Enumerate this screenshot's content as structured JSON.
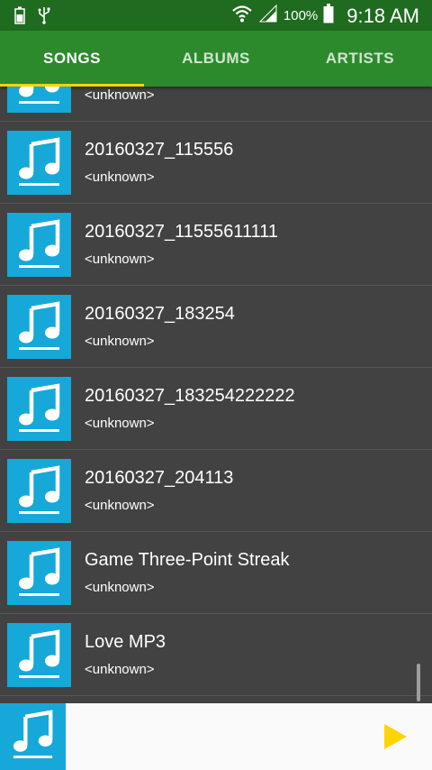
{
  "status_bar": {
    "battery_percent": "100%",
    "time": "9:18 AM",
    "icons": [
      "battery-saver-icon",
      "usb-icon",
      "wifi-icon",
      "signal-icon",
      "battery-icon"
    ]
  },
  "tabs": [
    {
      "label": "SONGS",
      "active": true
    },
    {
      "label": "ALBUMS",
      "active": false
    },
    {
      "label": "ARTISTS",
      "active": false
    }
  ],
  "songs": [
    {
      "title": "",
      "artist": "<unknown>"
    },
    {
      "title": "20160327_115556",
      "artist": "<unknown>"
    },
    {
      "title": "20160327_11555611111",
      "artist": "<unknown>"
    },
    {
      "title": "20160327_183254",
      "artist": "<unknown>"
    },
    {
      "title": "20160327_183254222222",
      "artist": "<unknown>"
    },
    {
      "title": "20160327_204113",
      "artist": "<unknown>"
    },
    {
      "title": "Game Three-Point Streak",
      "artist": "<unknown>"
    },
    {
      "title": "Love MP3",
      "artist": "<unknown>"
    }
  ],
  "colors": {
    "status_bar": "#1f6b1f",
    "tab_bar": "#2c8a2c",
    "tab_indicator": "#ffd400",
    "list_background": "#424242",
    "thumbnail": "#16a8d8",
    "play_button": "#ffd400"
  }
}
